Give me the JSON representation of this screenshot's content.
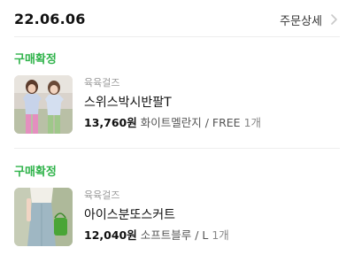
{
  "header": {
    "date": "22.06.06",
    "detail_label": "주문상세"
  },
  "orders": [
    {
      "status": "구매확정",
      "brand": "육육걸즈",
      "name": "스위스박시반팔T",
      "price": "13,760원",
      "option": "화이트멜란지 / FREE",
      "qty": "1개"
    },
    {
      "status": "구매확정",
      "brand": "육육걸즈",
      "name": "아이스분또스커트",
      "price": "12,040원",
      "option": "소프트블루 / L",
      "qty": "1개"
    }
  ],
  "colors": {
    "accent_green": "#2fb34a",
    "divider": "#eeeeee",
    "muted": "#999999"
  },
  "icons": {
    "detail_chevron": "chevron-right-icon"
  }
}
